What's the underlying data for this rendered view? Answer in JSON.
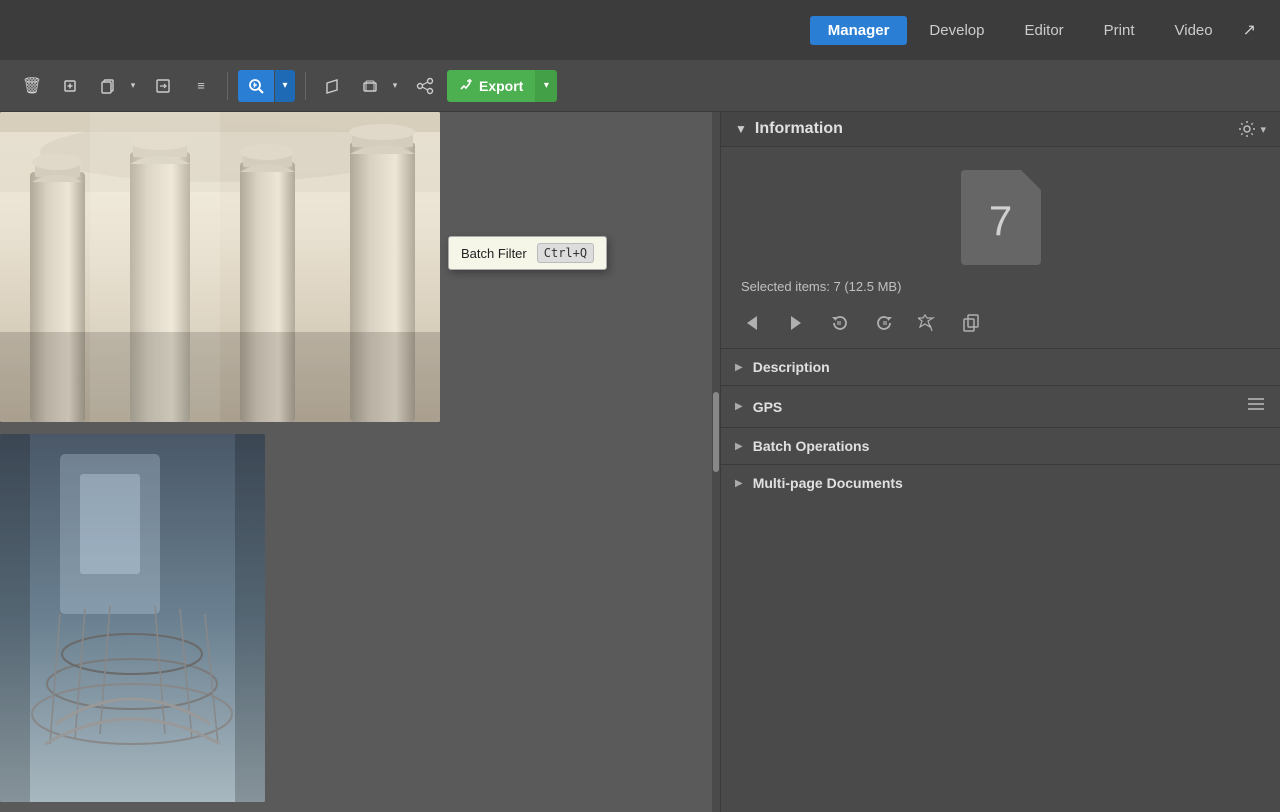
{
  "nav": {
    "tabs": [
      {
        "id": "manager",
        "label": "Manager",
        "active": true
      },
      {
        "id": "develop",
        "label": "Develop",
        "active": false
      },
      {
        "id": "editor",
        "label": "Editor",
        "active": false
      },
      {
        "id": "print",
        "label": "Print",
        "active": false
      },
      {
        "id": "video",
        "label": "Video",
        "active": false
      }
    ],
    "external_icon": "↗"
  },
  "toolbar": {
    "buttons": [
      {
        "id": "delete",
        "icon": "🗑",
        "label": "Delete"
      },
      {
        "id": "add",
        "icon": "➕",
        "label": "Add"
      },
      {
        "id": "copy",
        "icon": "⧉",
        "label": "Copy"
      },
      {
        "id": "move",
        "icon": "📋",
        "label": "Move"
      },
      {
        "id": "num",
        "icon": "≡",
        "label": "Number"
      }
    ],
    "batch_filter_label": "Batch Filter",
    "batch_filter_shortcut": "Ctrl+Q",
    "batch_filter_icon": "⚙",
    "share_icon": "↗",
    "export_label": "Export",
    "export_icon": "↪"
  },
  "right_panel": {
    "title": "Information",
    "collapse_icon": "▼",
    "settings_icon": "⚙",
    "settings_dropdown": "▾",
    "selected_count": "7",
    "selected_info": "Selected items: 7 (12.5 MB)",
    "action_icons": [
      {
        "id": "prev",
        "icon": "◀",
        "label": "Previous"
      },
      {
        "id": "next",
        "icon": "▶",
        "label": "Next"
      },
      {
        "id": "rotate-ccw",
        "icon": "↺",
        "label": "Rotate CCW"
      },
      {
        "id": "rotate-cw",
        "icon": "↻",
        "label": "Rotate CW"
      },
      {
        "id": "stars",
        "icon": "✦",
        "label": "Stars"
      },
      {
        "id": "pages",
        "icon": "⊞",
        "label": "Pages"
      }
    ],
    "sections": [
      {
        "id": "description",
        "label": "Description",
        "expanded": false
      },
      {
        "id": "gps",
        "label": "GPS",
        "expanded": false,
        "has_menu": true
      },
      {
        "id": "batch-operations",
        "label": "Batch Operations",
        "expanded": false
      },
      {
        "id": "multi-page",
        "label": "Multi-page Documents",
        "expanded": false
      }
    ]
  },
  "tooltip": {
    "label": "Batch Filter",
    "shortcut": "Ctrl+Q"
  }
}
